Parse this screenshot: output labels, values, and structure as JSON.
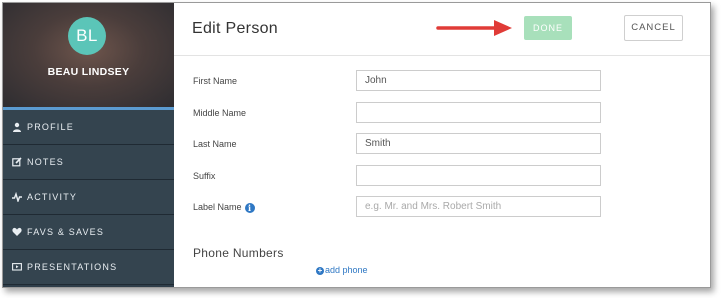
{
  "profile": {
    "initials": "BL",
    "name": "BEAU LINDSEY",
    "avatar_color": "#5bc5b8"
  },
  "sidebar": {
    "items": [
      {
        "label": "PROFILE",
        "icon": "user-icon"
      },
      {
        "label": "NOTES",
        "icon": "edit-icon"
      },
      {
        "label": "ACTIVITY",
        "icon": "activity-icon"
      },
      {
        "label": "FAVS & SAVES",
        "icon": "heart-icon"
      },
      {
        "label": "PRESENTATIONS",
        "icon": "presentation-icon"
      }
    ],
    "accent_color": "#5b9bd1"
  },
  "header": {
    "title": "Edit Person",
    "done_label": "DONE",
    "cancel_label": "CANCEL",
    "done_color": "#a8e0bb",
    "arrow_color": "#e03b37"
  },
  "form": {
    "first_name": {
      "label": "First Name",
      "value": "John",
      "placeholder": ""
    },
    "middle_name": {
      "label": "Middle Name",
      "value": "",
      "placeholder": ""
    },
    "last_name": {
      "label": "Last Name",
      "value": "Smith",
      "placeholder": ""
    },
    "suffix": {
      "label": "Suffix",
      "value": "",
      "placeholder": ""
    },
    "label_name": {
      "label": "Label Name",
      "value": "",
      "placeholder": "e.g. Mr. and Mrs. Robert Smith",
      "icon": "info-icon"
    }
  },
  "phone_section": {
    "title": "Phone Numbers",
    "add_label": "add phone"
  }
}
